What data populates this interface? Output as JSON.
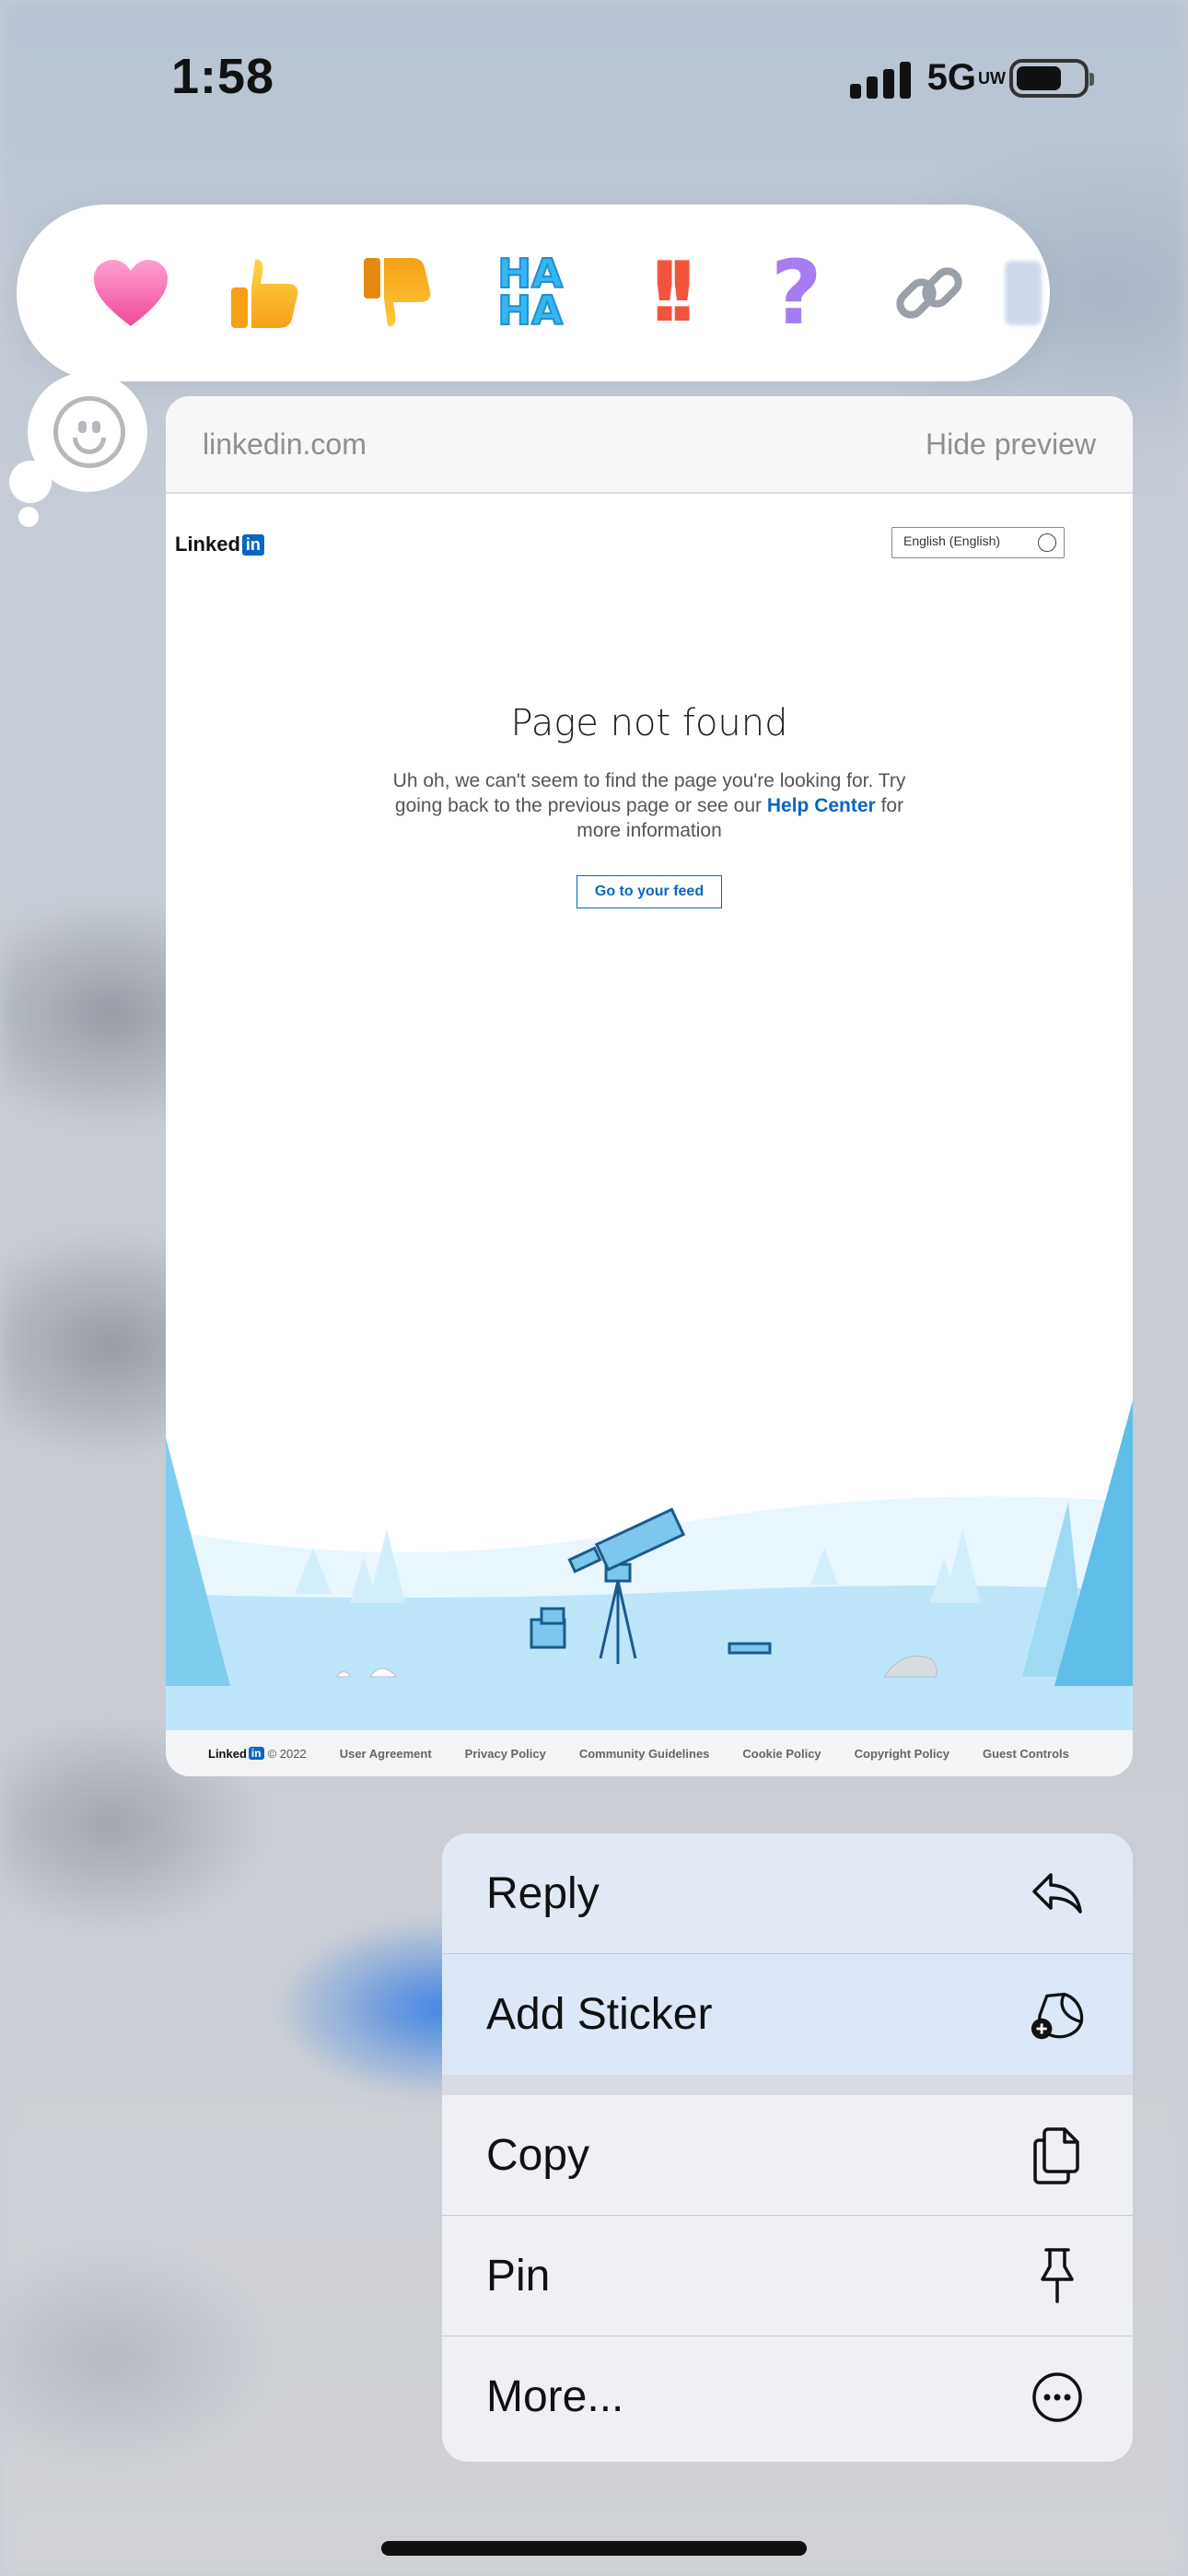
{
  "status_bar": {
    "time": "1:58",
    "network": "5G",
    "network_suffix": "UW"
  },
  "reactions": {
    "items": [
      {
        "name": "heart",
        "glyph": "❤"
      },
      {
        "name": "thumbs-up",
        "glyph": "👍"
      },
      {
        "name": "thumbs-down",
        "glyph": "👎"
      },
      {
        "name": "haha",
        "glyph": "HA HA"
      },
      {
        "name": "exclamation",
        "glyph": "!!"
      },
      {
        "name": "question",
        "glyph": "?"
      },
      {
        "name": "link",
        "glyph": "🔗"
      }
    ]
  },
  "preview": {
    "domain": "linkedin.com",
    "hide_label": "Hide preview",
    "page": {
      "logo_text": "Linked",
      "logo_badge": "in",
      "language": "English (English)",
      "title": "Page not found",
      "message_before": "Uh oh, we can't seem to find the page you're looking for. Try going back to the previous page or see our",
      "message_link": "Help Center",
      "message_after": "for more information",
      "button": "Go to your feed",
      "footer": {
        "copyright": "© 2022",
        "links": [
          "User Agreement",
          "Privacy Policy",
          "Community Guidelines",
          "Cookie Policy",
          "Copyright Policy",
          "Guest Controls"
        ]
      }
    }
  },
  "menu": {
    "reply": "Reply",
    "add_sticker": "Add Sticker",
    "copy": "Copy",
    "pin": "Pin",
    "more": "More..."
  },
  "colors": {
    "accent": "#0a66c2",
    "sky": "#bde6fa",
    "tree": "#7fcdef"
  }
}
